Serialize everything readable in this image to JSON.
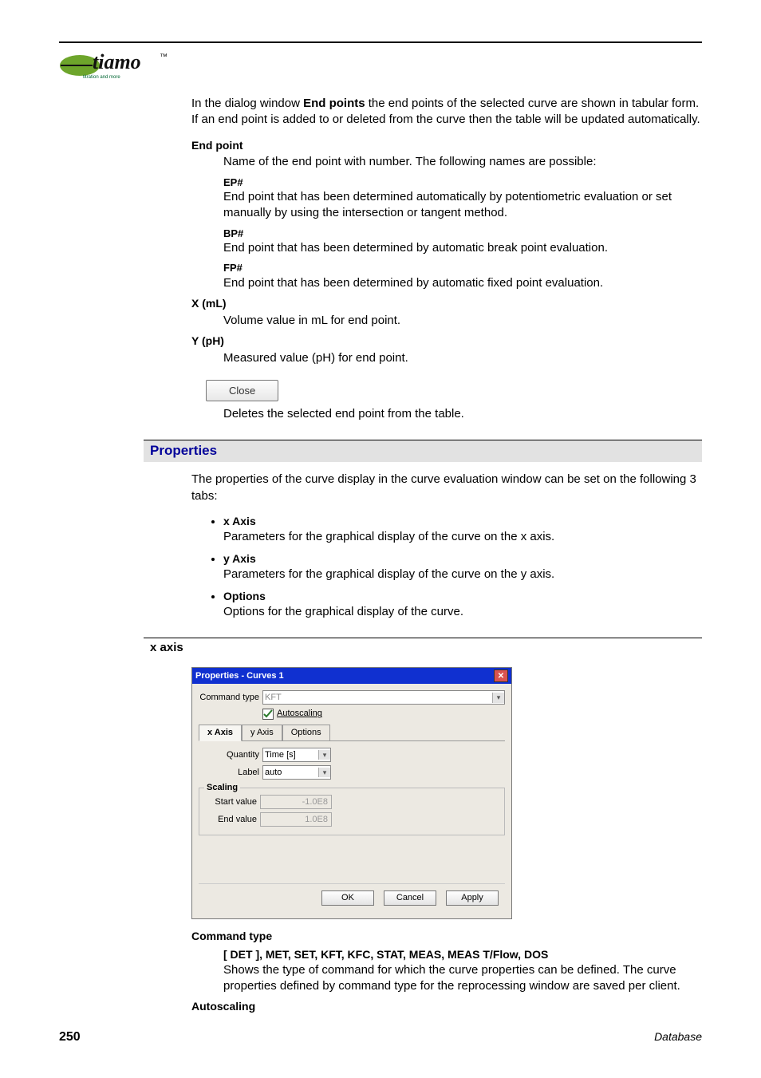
{
  "logo_text": "tiamo",
  "logo_tag_tm": "™",
  "logo_subtitle": "titration and more",
  "intro_prefix": "In the dialog window ",
  "intro_bold": "End points",
  "intro_suffix": " the end points of the selected curve are shown in tabular form. If an end point is added to or deleted from the curve then the table will be updated automatically.",
  "endpoint": {
    "heading": "End point",
    "desc": "Name of the end point with number. The following names are possible:",
    "ep_label": "EP#",
    "ep_desc": "End point that has been determined automatically by potentiometric evaluation or set manually by using the intersection or tangent method.",
    "bp_label": "BP#",
    "bp_desc": "End point that has been determined by automatic break point evaluation.",
    "fp_label": "FP#",
    "fp_desc": "End point that has been determined by automatic fixed point evaluation."
  },
  "xml": {
    "heading": "X (mL)",
    "desc": "Volume value in mL for end point."
  },
  "yph": {
    "heading": "Y (pH)",
    "desc": "Measured value (pH) for end point."
  },
  "close": {
    "label": "Close",
    "desc": "Deletes the selected end point from the table."
  },
  "properties": {
    "heading": "Properties",
    "intro": "The properties of the curve display in the curve evaluation window can be set on the following 3 tabs:",
    "items": [
      {
        "title": "x Axis",
        "desc": "Parameters for the graphical display of the curve on the x axis."
      },
      {
        "title": "y Axis",
        "desc": "Parameters for the graphical display of the curve on the y axis."
      },
      {
        "title": "Options",
        "desc": "Options for the graphical display of the curve."
      }
    ]
  },
  "xaxis_heading": "x axis",
  "dialog": {
    "title": "Properties - Curves 1",
    "cmd_label": "Command type",
    "cmd_value": "KFT",
    "autoscaling": "Autoscaling",
    "tab_x": "x Axis",
    "tab_y": "y Axis",
    "tab_opt": "Options",
    "quantity_label": "Quantity",
    "quantity_value": "Time [s]",
    "label_label": "Label",
    "label_value": "auto",
    "scaling": "Scaling",
    "start_label": "Start value",
    "start_value": "-1.0E8",
    "end_label": "End value",
    "end_value": "1.0E8",
    "ok": "OK",
    "cancel": "Cancel",
    "apply": "Apply"
  },
  "cmd_type": {
    "heading": "Command type",
    "values": "[ DET ], MET, SET, KFT, KFC, STAT, MEAS, MEAS T/Flow, DOS",
    "desc": "Shows the type of command for which the curve properties can be defined. The curve properties defined by command type for the reprocessing window are saved per client."
  },
  "autoscaling_heading": "Autoscaling",
  "footer": {
    "page": "250",
    "section": "Database"
  }
}
